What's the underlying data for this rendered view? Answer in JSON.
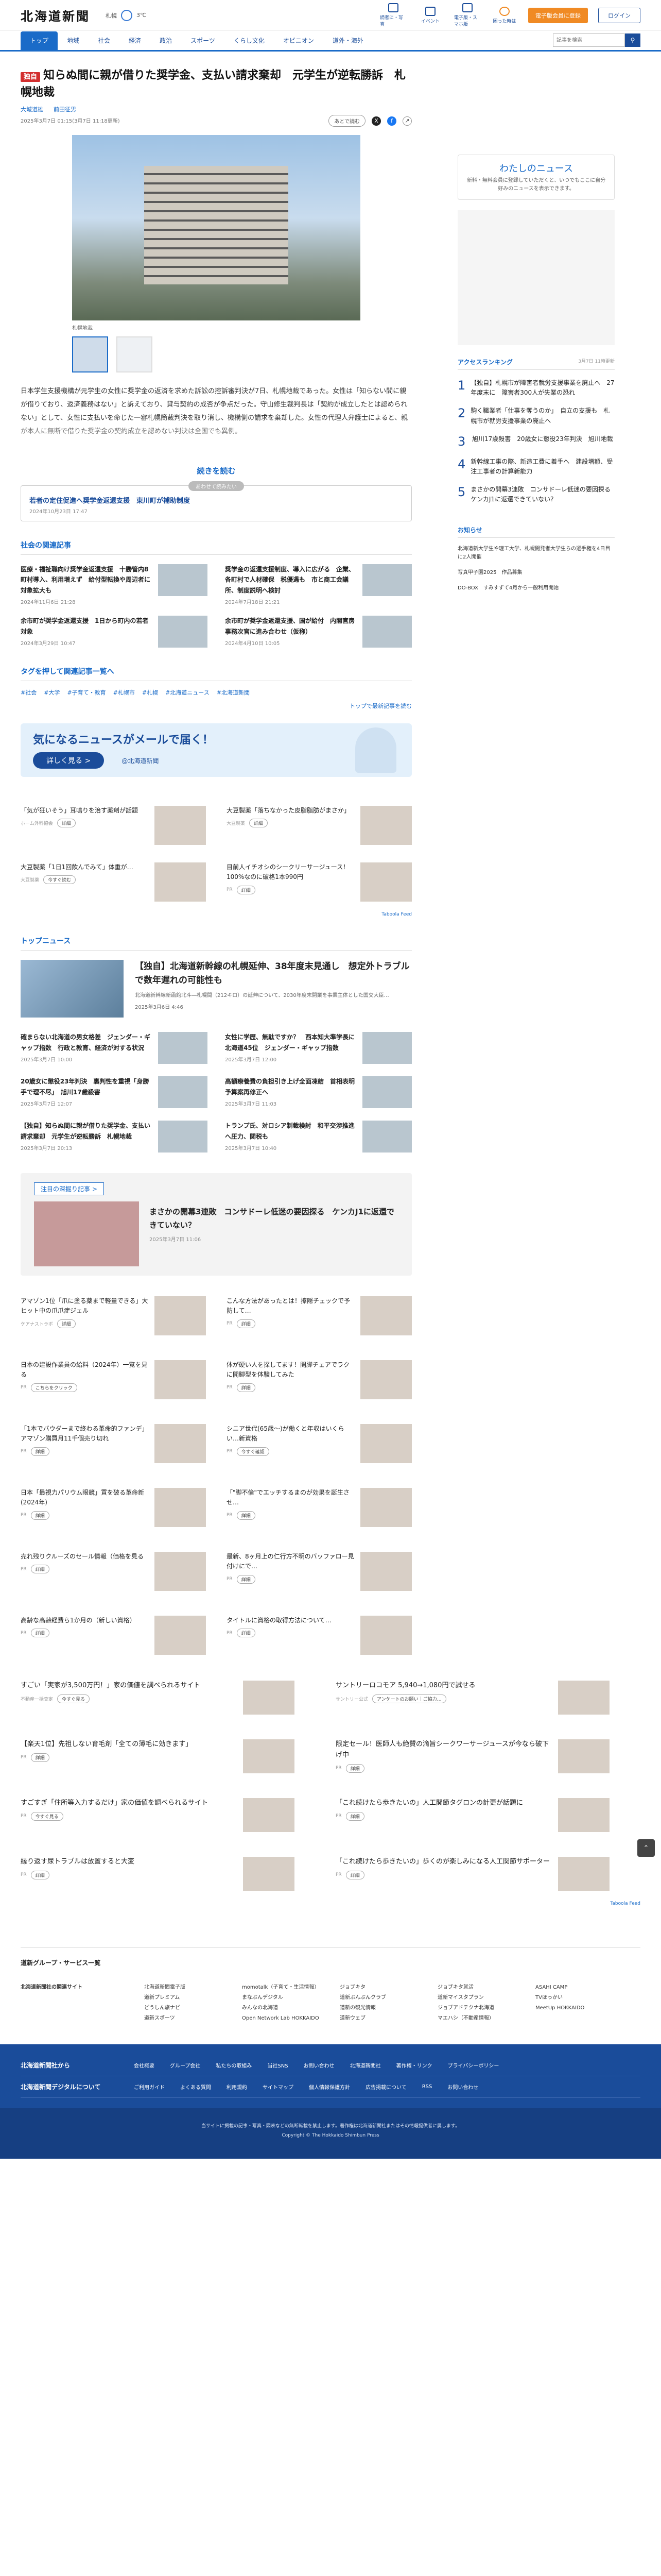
{
  "header": {
    "logo": "北海道新聞",
    "weather": [
      "札幌",
      "3℃"
    ],
    "icons": [
      "読者に・写真",
      "イベント",
      "電子版・スマホ版",
      "困った時は"
    ],
    "member_button": "電子版会員に登録",
    "login_button": "ログイン"
  },
  "nav": {
    "items": [
      "トップ",
      "地域",
      "社会",
      "経済",
      "政治",
      "スポーツ",
      "くらし文化",
      "オピニオン",
      "道外・海外"
    ],
    "search_placeholder": "記事を検索"
  },
  "article": {
    "exclusive_label": "独自",
    "title": "知らぬ間に親が借りた奨学金、支払い請求棄却　元学生が逆転勝訴　札幌地裁",
    "author": "大城道雄",
    "author2": "前田征男",
    "dates": "2025年3月7日 01:15(3月7日 11:18更新)",
    "keep": "あとで読む",
    "caption": "札幌地裁",
    "body": "日本学生支援機構が元学生の女性に奨学金の返済を求めた訴訟の控訴審判決が7日、札幌地裁であった。女性は「知らない間に親が借りており、返済義務はない」と訴えており、貸与契約の成否が争点だった。守山修生裁判長は「契約が成立したとは認められない」として、女性に支払いを命じた一審札幌簡裁判決を取り消し、機構側の請求を棄却した。女性の代理人弁護士によると、親が本人に無断で借りた奨学金の契約成立を認めない判決は全国でも異例。",
    "read_more": "続きを読む",
    "next_label": "あわせて読みたい",
    "next_title": "若者の定住促進へ奨学金返還支援　東川町が補助制度",
    "next_date": "2024年10月23日 17:47"
  },
  "related": {
    "title": "社会の関連記事",
    "items": [
      {
        "title": "医療・福祉職向け奨学金返還支援　十勝管内8町村導入、利用増えず　給付型転換や周辺者に対象拡大も",
        "date": "2024年11月6日 21:28"
      },
      {
        "title": "奨学金の返還支援制度、導入に広がる　企業、各町村で人材確保　税優遇も　市と商工会議所、制度説明へ検討",
        "date": "2024年7月18日 21:21"
      },
      {
        "title": "余市町が奨学金返還支援　1日から町内の若者対象",
        "date": "2024年3月29日 10:47"
      },
      {
        "title": "余市町が奨学金返還支援、国が給付　内閣官房事務次官に進み合わせ（仮称）",
        "date": "2024年4月10日 10:05"
      }
    ]
  },
  "tags": {
    "title": "タグを押して関連記事一覧へ",
    "items": [
      "#社会",
      "#大学",
      "#子育て・教育",
      "#札幌市",
      "#札幌",
      "#北海道ニュース",
      "#北海道新聞"
    ],
    "more": "トップで最新記事を読む"
  },
  "mail_banner": {
    "title": "気になるニュースがメールで届く！",
    "button": "詳しく見る >",
    "sub": "@北海道新聞"
  },
  "ads1": [
    {
      "title": "「気が狂いそう」耳鳴りを治す薬剤が話題",
      "src": "ホーム外科協会",
      "btn": "詳細"
    },
    {
      "title": "大豆製薬「落ちなかった皮脂脂肪がまさか」",
      "src": "大豆製薬",
      "btn": "詳細"
    },
    {
      "title": "大豆製薬「1日1回飲んでみて」体重が…",
      "src": "大豆製薬",
      "btn": "今すぐ読む"
    },
    {
      "title": "目前人イチオシのシークリーサージュース！100%なのに破格1本990円",
      "src": "PR",
      "btn": "詳細"
    }
  ],
  "top_news": {
    "title": "トップニュース",
    "lead_title": "【独自】北海道新幹線の札幌延伸、38年度末見通し　想定外トラブルで数年遅れの可能性も",
    "lead_desc": "北海道新幹線新函館北斗―札幌間（212キロ）の延伸について、2030年度末開業を事業主体とした国交大臣…",
    "lead_date": "2025年3月6日 4:46",
    "items": [
      {
        "title": "確まらない北海道の男女格差　ジェンダー・ギャップ指数　行政と教育、経済が対する状況",
        "date": "2025年3月7日 10:00"
      },
      {
        "title": "女性に学歴、無駄ですか？　西本知大準学長に北海道45位　ジェンダー・ギャップ指数",
        "date": "2025年3月7日 12:00"
      },
      {
        "title": "20歳女に懲役23年判決　裏判性を重視「身勝手で理不尽」　旭川17歳殺害",
        "date": "2025年3月7日 12:07"
      },
      {
        "title": "高額療養費の負担引き上げ全面凍結　首相表明　予算案再修正へ",
        "date": "2025年3月7日 11:03"
      },
      {
        "title": "【独自】知らぬ間に親が借りた奨学金、支払い請求棄却　元学生が逆転勝訴　札幌地裁",
        "date": "2025年3月7日 20:13"
      },
      {
        "title": "トランプ氏、対ロシア制裁検討　和平交渉推進へ圧力、関税も",
        "date": "2025年3月7日 10:40"
      }
    ]
  },
  "feature": {
    "label": "注目の深掘り記事 >",
    "title": "まさかの開幕3連敗　コンサドーレ低迷の要因探る　ケンカJ1に返還できていない？",
    "date": "2025年3月7日 11:06"
  },
  "ads2": [
    {
      "title": "アマゾン1位「爪に塗る薬まで軽量できる」大ヒット中の爪爪症ジェル",
      "src": "ケアナストラボ",
      "btn": "詳細"
    },
    {
      "title": "こんな方法があったとは！擦隠チェックで予防して…",
      "src": "PR",
      "btn": "詳細"
    },
    {
      "title": "日本の建設作業員の給料（2024年）一覧を見る",
      "src": "PR",
      "btn": "こちらをクリック"
    },
    {
      "title": "体が硬い人を探してます！開脚チェアでラクに開脚型を体験してみた",
      "src": "PR",
      "btn": "詳細"
    },
    {
      "title": "「1本でバウダーまで終わる革命的ファンデ」アマゾン購買月11千個売り切れ",
      "src": "PR",
      "btn": "詳細"
    },
    {
      "title": "シニア世代(65歳～)が働くと年収はいくらい…新資格",
      "src": "PR",
      "btn": "今すぐ確認"
    },
    {
      "title": "日本「最視力パリウム眼鏡」買を破る革命新(2024年)",
      "src": "PR",
      "btn": "詳細"
    },
    {
      "title": "「\"脚不倫\"でエッチするまのが効果を誕生させ…",
      "src": "PR",
      "btn": "詳細"
    },
    {
      "title": "売れ残りクルーズのセール情報（価格を見る",
      "src": "PR",
      "btn": "詳細"
    },
    {
      "title": "最新、8ヶ月上の仁行方不明のバッファロー見付けにで…",
      "src": "PR",
      "btn": "詳細"
    },
    {
      "title": "高齢な高齢経費ら1か月の（新しい資格）",
      "src": "PR",
      "btn": "詳細"
    },
    {
      "title": "タイトルに資格の取得方法について…",
      "src": "PR",
      "btn": "詳細"
    }
  ],
  "ads3": [
    {
      "title": "すごい「実家が3,500万円！」家の価値を調べられるサイト",
      "src": "不動産一括査定",
      "btn": "今すぐ見る"
    },
    {
      "title": "サントリーロコモア 5,940→1,080円で試せる",
      "src": "サントリー公式",
      "btn": "アンケートのお願い｜ご協力…"
    },
    {
      "title": "【楽天1位】先祖しない育毛剤「全ての薄毛に効きます」",
      "src": "PR",
      "btn": "詳細"
    },
    {
      "title": "限定セール！医師人も絶賛の滴旨シークワーサージュースが今なら破下げ中",
      "src": "PR",
      "btn": "詳細"
    },
    {
      "title": "すごすぎ「住所等入力するだけ」家の価値を調べられるサイト",
      "src": "PR",
      "btn": "今すぐ見る"
    },
    {
      "title": "「これ続けたら歩きたいの」人工関節タグロンの計更が話題に",
      "src": "PR",
      "btn": "詳細"
    },
    {
      "title": "縁り返す尿トラブルは放置すると大変",
      "src": "PR",
      "btn": "詳細"
    },
    {
      "title": "「これ続けたら歩きたいの」歩くのが楽しみになる人工関節サポーター",
      "src": "PR",
      "btn": "詳細"
    }
  ],
  "sidebar": {
    "my_news": "わたしのニュース",
    "my_news_sub": "新料・無料会員に登録していただくと、いつでもここに自分好みのニュースを表示できます。",
    "ranking_title": "アクセスランキング",
    "ranking_date": "3月7日 11時更新",
    "ranking": [
      {
        "n": "1",
        "title": "【独自】札幌市が障害者就労支援事業を廃止へ　27年度末に　障害者300人が失業の恐れ"
      },
      {
        "n": "2",
        "title": "駒く職業者「仕事を奪うのか」　自立の支援も　札幌市が就労支援事業の廃止へ"
      },
      {
        "n": "3",
        "title": "旭川17歳殺害　20歳女に懲役23年判決　旭川地裁"
      },
      {
        "n": "4",
        "title": "新幹線工事の際、新造工費に着手へ　建設増額、受注工事者の計算新能力"
      },
      {
        "n": "5",
        "title": "まさかの開幕3連敗　コンサドーレ低迷の要因探る　ケンカJ1に返還できていない？"
      }
    ],
    "notice_title": "お知らせ",
    "notices": [
      "北海道新大学生や理工大学、札幌開発者大学生らの選手権を4日目に2人開催",
      "写真甲子園2025　作品募集",
      "DO-BOX　すみすずて4月から一般利用開始"
    ]
  },
  "group": {
    "title": "道新グループ・サービス一覧",
    "head": "北海道新聞社の関連サイト",
    "cols": [
      [
        "北海道新聞電子版",
        "道新プレミアム",
        "どうしん旅ナビ",
        "道新スポーツ"
      ],
      [
        "momotalk（子育て・生活情報）",
        "まなぶんデジタル",
        "みんなの北海道",
        "Open Network Lab HOKKAIDO"
      ],
      [
        "ジョブキタ",
        "道新ぶんぶんクラブ",
        "道新の観光情報",
        "道新ウェブ"
      ],
      [
        "ジョブキタ就活",
        "道新マイスタプラン",
        "ジョブアドテクナ北海道",
        "マエハシ（不動産情報）"
      ],
      [
        "ASAHI CAMP",
        "TVほっかい",
        "MeetUp HOKKAIDO"
      ]
    ]
  },
  "footer": {
    "row1_head": "北海道新聞社から",
    "row1": [
      "会社概要",
      "グループ会社",
      "私たちの取組み",
      "当社SNS",
      "お問い合わせ",
      "北海道新聞社",
      "著作権・リンク",
      "プライバシーポリシー"
    ],
    "row2_head": "北海道新聞デジタルについて",
    "row2": [
      "ご利用ガイド",
      "よくある質問",
      "利用規約",
      "サイトマップ",
      "個人情報保護方針",
      "広告掲載について",
      "RSS",
      "お問い合わせ"
    ],
    "copyright": "Copyright © The Hokkaido Shimbun Press",
    "notice": "当サイトに掲載の記事・写真・図表などの無断転載を禁止します。著作権は北海道新聞社またはその情報提供者に属します。"
  },
  "powered": "Taboola Feed"
}
